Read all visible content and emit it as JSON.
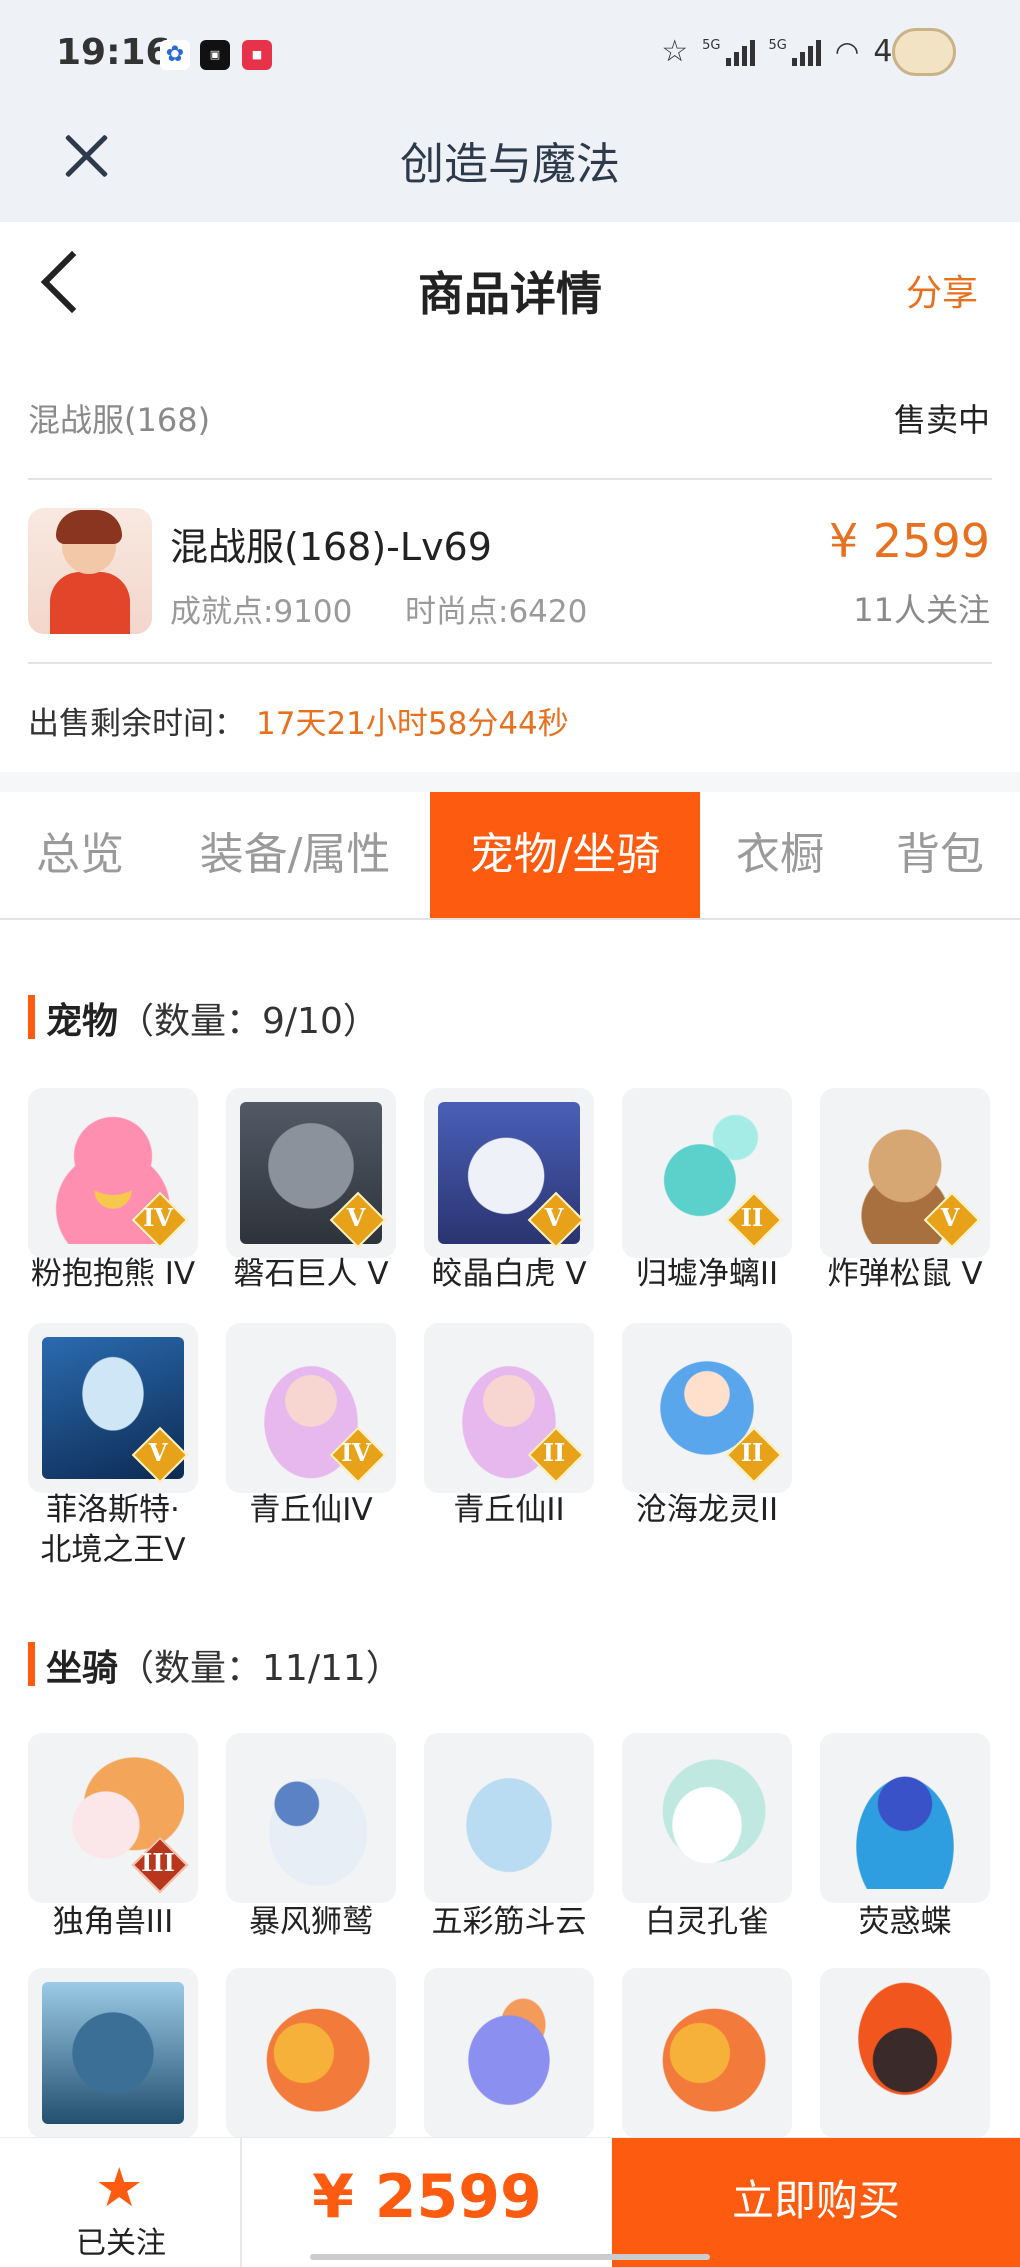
{
  "status_bar": {
    "time": "19:16",
    "battery": "46%",
    "signal_label": "5G"
  },
  "app_bar": {
    "title": "创造与魔法"
  },
  "page_header": {
    "title": "商品详情",
    "share_label": "分享"
  },
  "listing": {
    "server": "混战服(168)",
    "status": "售卖中",
    "character_name": "混战服(168)-Lv69",
    "achievement": "成就点:9100",
    "fashion": "时尚点:6420",
    "price": "¥ 2599",
    "followers": "11人关注",
    "time_label": "出售剩余时间：",
    "time_left": "17天21小时58分44秒"
  },
  "tabs": [
    {
      "label": "总览",
      "active": false
    },
    {
      "label": "装备/属性",
      "active": false
    },
    {
      "label": "宠物/坐骑",
      "active": true
    },
    {
      "label": "衣橱",
      "active": false
    },
    {
      "label": "背包",
      "active": false
    }
  ],
  "pets_section": {
    "title": "宠物",
    "count": "（数量：9/10）"
  },
  "pets": [
    {
      "name": "粉抱抱熊 IV",
      "badge": "IV",
      "icon": "pink-bear-art"
    },
    {
      "name": "磐石巨人 V",
      "badge": "V",
      "icon": "stone-giant-art"
    },
    {
      "name": "皎晶白虎 V",
      "badge": "V",
      "icon": "white-tiger-art"
    },
    {
      "name": "归墟净螭II",
      "badge": "II",
      "icon": "teal-dragon-art"
    },
    {
      "name": "炸弹松鼠 V",
      "badge": "V",
      "icon": "squirrel-art"
    },
    {
      "name": "菲洛斯特·北境之王V",
      "name_line1": "菲洛斯特·",
      "name_line2": "北境之王V",
      "badge": "V",
      "icon": "frost-king-art"
    },
    {
      "name": "青丘仙IV",
      "badge": "IV",
      "icon": "fox-fairy-art"
    },
    {
      "name": "青丘仙II",
      "badge": "II",
      "icon": "fox-fairy-art"
    },
    {
      "name": "沧海龙灵II",
      "badge": "II",
      "icon": "dragon-spirit-art"
    }
  ],
  "mounts_section": {
    "title": "坐骑",
    "count": "（数量：11/11）"
  },
  "mounts": [
    {
      "name": "独角兽III",
      "badge": "III",
      "icon": "unicorn-art"
    },
    {
      "name": "暴风狮鹫",
      "icon": "griffin-art"
    },
    {
      "name": "五彩筋斗云",
      "icon": "cloud-art"
    },
    {
      "name": "白灵孔雀",
      "icon": "peacock-art"
    },
    {
      "name": "荧惑蝶",
      "icon": "butterfly-art"
    },
    {
      "name": "",
      "icon": "ice-dragon-art"
    },
    {
      "name": "",
      "icon": "fire-bird-art"
    },
    {
      "name": "",
      "icon": "purple-dragon-art"
    },
    {
      "name": "",
      "icon": "fire-bird-art"
    },
    {
      "name": "",
      "icon": "fire-beast-art"
    }
  ],
  "bottom_bar": {
    "follow_label": "已关注",
    "price": "¥ 2599",
    "buy_label": "立即购买"
  },
  "colors": {
    "accent": "#fd5b10",
    "price": "#e8711f",
    "badge_gold": "#e7a21a",
    "header_bg": "#eef2f6"
  }
}
